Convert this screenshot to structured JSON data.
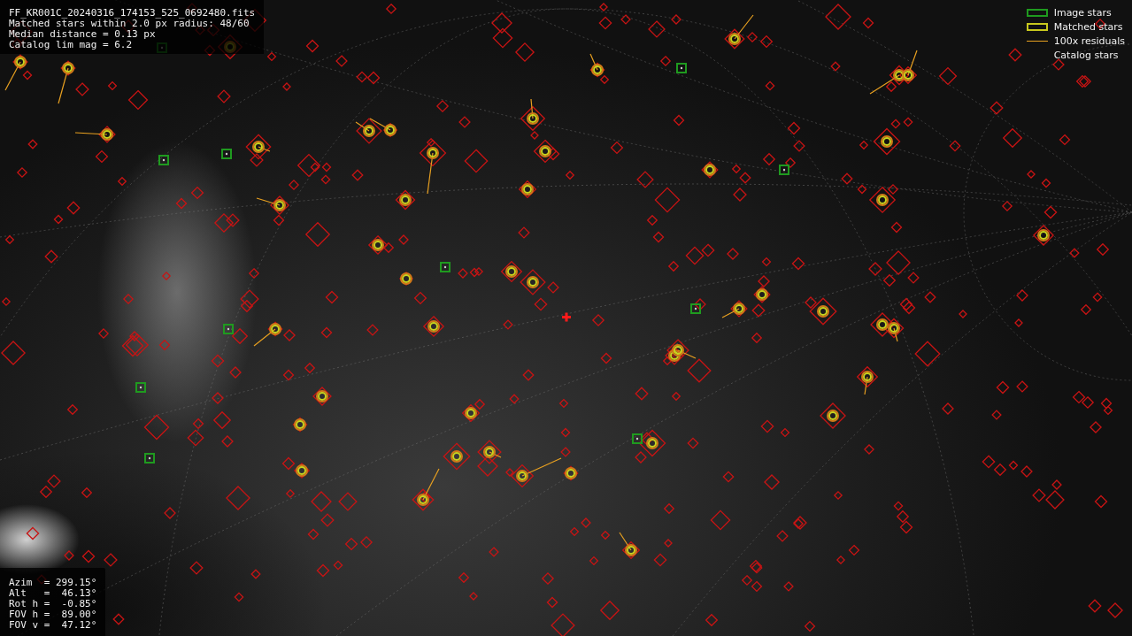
{
  "image_info": {
    "lines": [
      "FF_KR001C_20240316_174153_525_0692480.fits",
      "Matched stars within 2.0 px radius: 48/60",
      "Median distance = 0.13 px",
      "Catalog lim mag = 6.2"
    ]
  },
  "legend": [
    {
      "label": "Image stars",
      "kind": "box",
      "color": "#1f9a1f"
    },
    {
      "label": "Matched stars",
      "kind": "box",
      "color": "#c8c81e"
    },
    {
      "label": "100x residuals",
      "kind": "line",
      "color": "#e8a020"
    },
    {
      "label": "Catalog stars",
      "kind": "none"
    }
  ],
  "pointing": {
    "lines": [
      "Azim  = 299.15°",
      "Alt   =  46.13°",
      "Rot h =  -0.85°",
      "FOV h =  89.00°",
      "FOV v =  47.12°"
    ]
  }
}
